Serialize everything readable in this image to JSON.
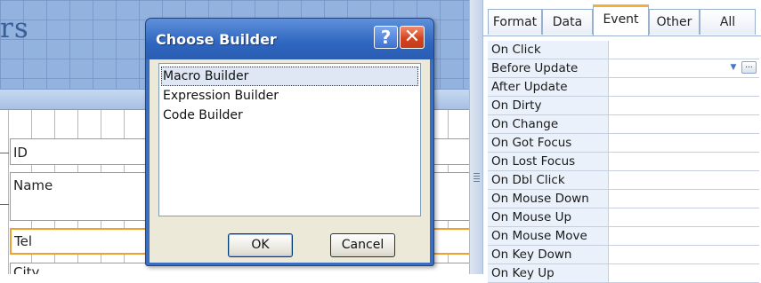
{
  "form": {
    "header_text": "rs",
    "fields": {
      "id_label": "ID",
      "name_label": "Name",
      "tel_label": "Tel",
      "city_label": "City"
    }
  },
  "property_sheet": {
    "tabs": [
      {
        "label": "Format",
        "active": false
      },
      {
        "label": "Data",
        "active": false
      },
      {
        "label": "Event",
        "active": true
      },
      {
        "label": "Other",
        "active": false
      },
      {
        "label": "All",
        "active": false
      }
    ],
    "rows": [
      {
        "name": "On Click",
        "value": ""
      },
      {
        "name": "Before Update",
        "value": "",
        "selected": true
      },
      {
        "name": "After Update",
        "value": ""
      },
      {
        "name": "On Dirty",
        "value": ""
      },
      {
        "name": "On Change",
        "value": ""
      },
      {
        "name": "On Got Focus",
        "value": ""
      },
      {
        "name": "On Lost Focus",
        "value": ""
      },
      {
        "name": "On Dbl Click",
        "value": ""
      },
      {
        "name": "On Mouse Down",
        "value": ""
      },
      {
        "name": "On Mouse Up",
        "value": ""
      },
      {
        "name": "On Mouse Move",
        "value": ""
      },
      {
        "name": "On Key Down",
        "value": ""
      },
      {
        "name": "On Key Up",
        "value": ""
      }
    ],
    "builder_button_label": "...",
    "dropdown_icon": "chevron-down-icon"
  },
  "dialog": {
    "title": "Choose Builder",
    "help_label": "?",
    "close_label": "✕",
    "options": [
      "Macro Builder",
      "Expression Builder",
      "Code Builder"
    ],
    "selected_option": "Macro Builder",
    "ok_label": "OK",
    "cancel_label": "Cancel"
  },
  "colors": {
    "form_header": "#93b3df",
    "dialog_title_bar": "#2f66bf",
    "active_tab_accent": "#f1b03b",
    "selected_field_border": "#f0a030"
  }
}
